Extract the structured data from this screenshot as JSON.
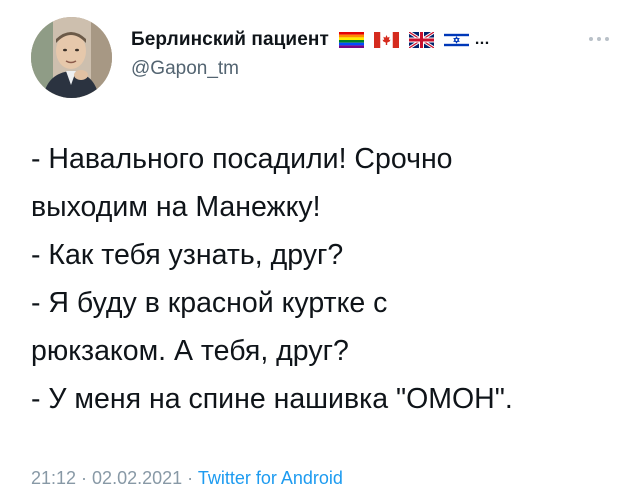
{
  "author": {
    "display_name": "Берлинский пациент",
    "handle": "@Gapon_tm",
    "name_flags": [
      "rainbow-flag-icon",
      "canada-flag-icon",
      "uk-flag-icon",
      "israel-flag-icon"
    ],
    "name_truncation": "..."
  },
  "tweet": {
    "lines": [
      "- Навального посадили! Срочно",
      "выходим на Манежку!",
      "- Как тебя узнать, друг?",
      "- Я буду в красной куртке с",
      "рюкзаком. А тебя, друг?",
      "- У меня на спине нашивка \"ОМОН\"."
    ]
  },
  "meta": {
    "time": "21:12",
    "separator": " · ",
    "date": "02.02.2021",
    "source": "Twitter for Android"
  },
  "colors": {
    "text": "#0f1419",
    "secondary": "#536471",
    "meta": "#8899a6",
    "link": "#1d9bf0"
  }
}
